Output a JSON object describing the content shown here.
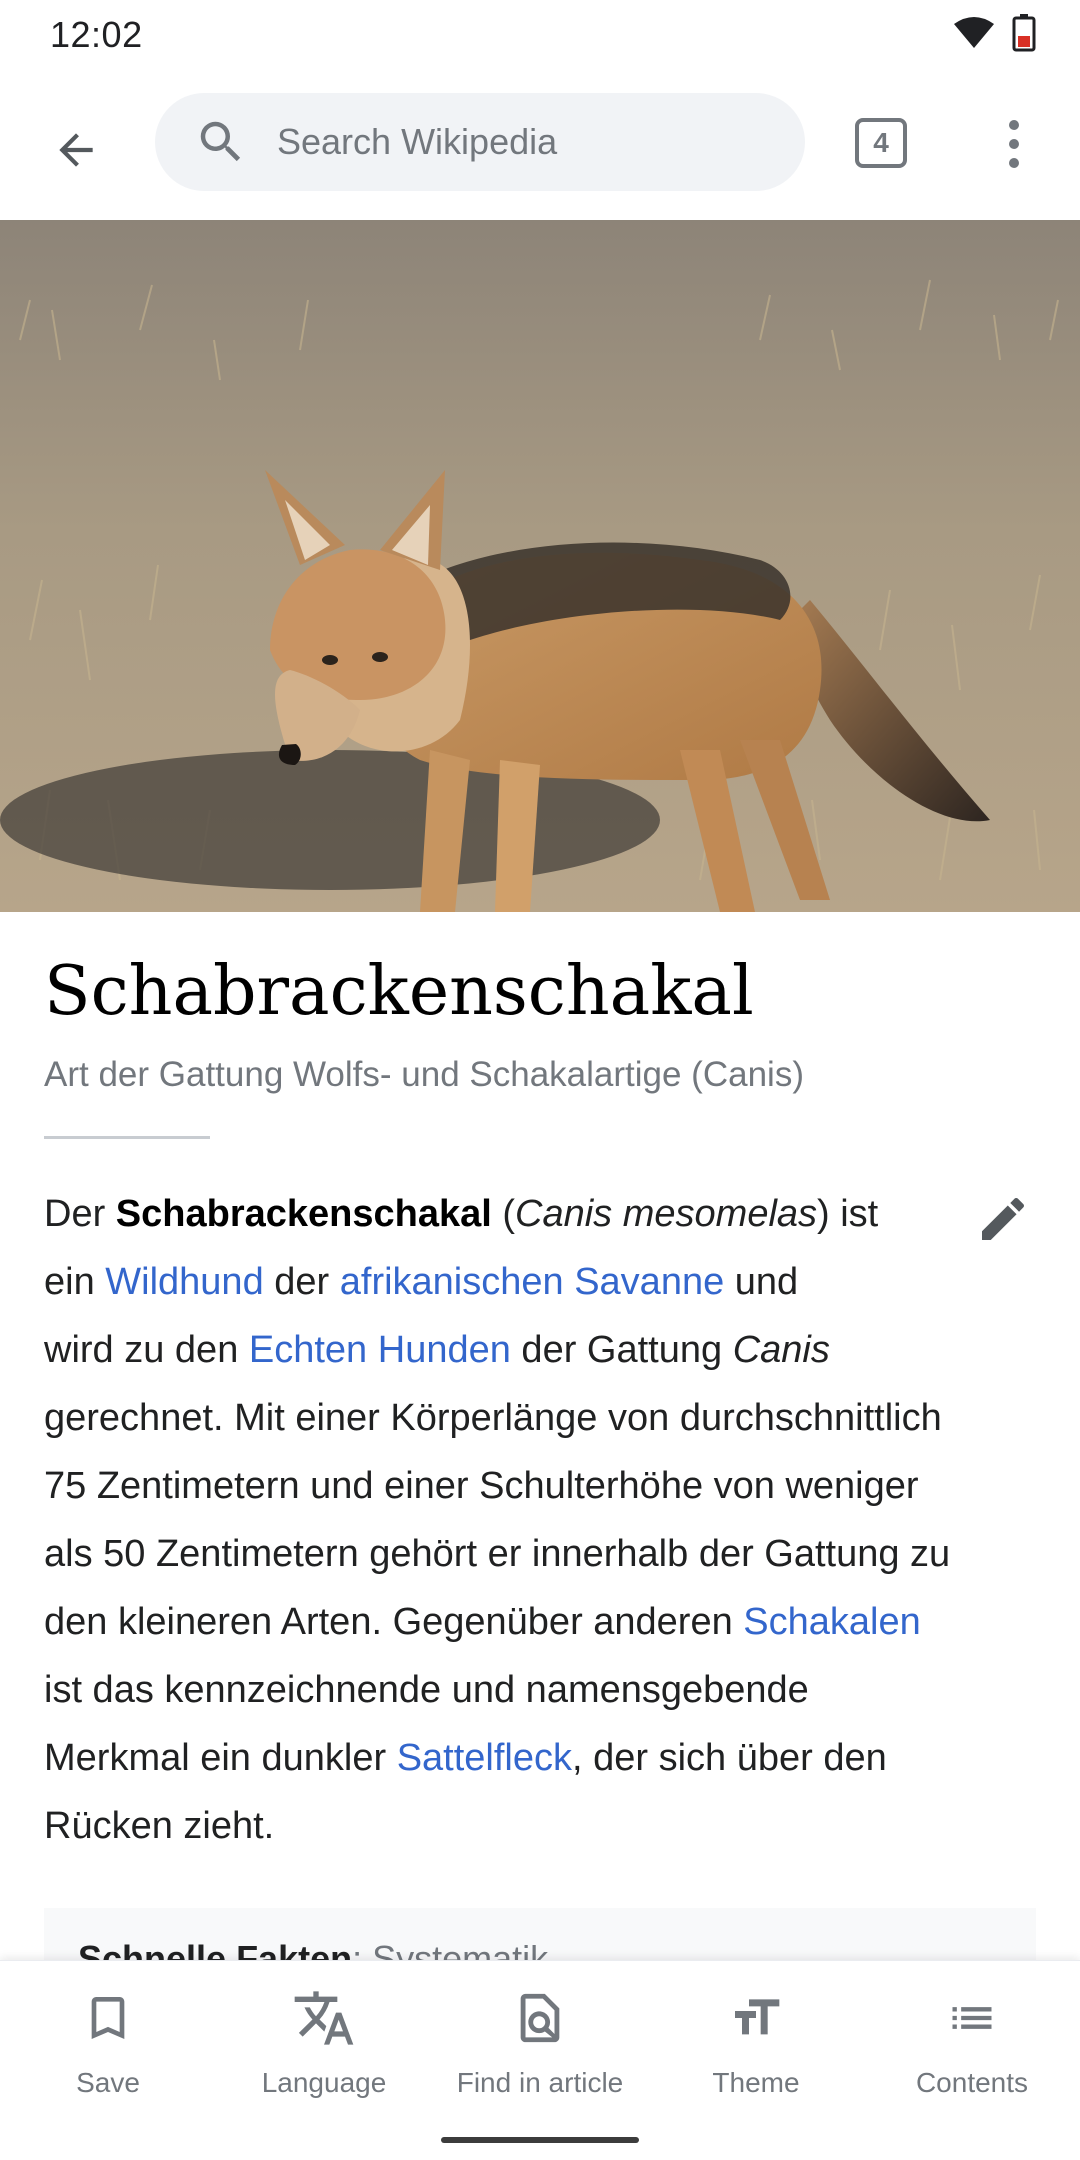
{
  "status_bar": {
    "time": "12:02"
  },
  "toolbar": {
    "search_placeholder": "Search Wikipedia",
    "tab_count": "4"
  },
  "article": {
    "title": "Schabrackenschakal",
    "description": "Art der Gattung Wolfs- und Schakalartige (Canis)",
    "lines": [
      [
        "Der ",
        {
          "b": "Schabrackenschakal"
        },
        " (",
        {
          "i": "Canis mesomelas"
        },
        ") ist"
      ],
      [
        "ein ",
        {
          "a": "Wildhund"
        },
        " der ",
        {
          "a": "afrikanischen Savanne"
        },
        " und"
      ],
      [
        "wird zu den ",
        {
          "a": "Echten Hunden"
        },
        " der Gattung ",
        {
          "i": "Canis"
        }
      ],
      [
        "gerechnet. Mit einer Körperlänge von durchschnittlich"
      ],
      [
        "75 Zentimetern und einer Schulterhöhe von weniger"
      ],
      [
        "als 50 Zentimetern gehört er innerhalb der Gattung zu"
      ],
      [
        "den kleineren Arten. Gegenüber anderen ",
        {
          "a": "Schakalen"
        }
      ],
      [
        "ist das kennzeichnende und namensgebende"
      ],
      [
        "Merkmal ein dunkler ",
        {
          "a": "Sattelfleck"
        },
        ", der sich über den"
      ],
      [
        "Rücken zieht."
      ]
    ],
    "quick_facts_label": "Schnelle Fakten",
    "quick_facts_separator": ": ",
    "quick_facts_value": "Systematik"
  },
  "bottom_bar": {
    "items": [
      {
        "label": "Save",
        "icon": "bookmark-icon"
      },
      {
        "label": "Language",
        "icon": "translate-icon"
      },
      {
        "label": "Find in article",
        "icon": "find-in-page-icon"
      },
      {
        "label": "Theme",
        "icon": "text-size-icon"
      },
      {
        "label": "Contents",
        "icon": "list-icon"
      }
    ]
  },
  "colors": {
    "link": "#3366cc",
    "secondary_text": "#72777d",
    "body_text": "#202122",
    "search_bg": "#f1f3f6"
  }
}
